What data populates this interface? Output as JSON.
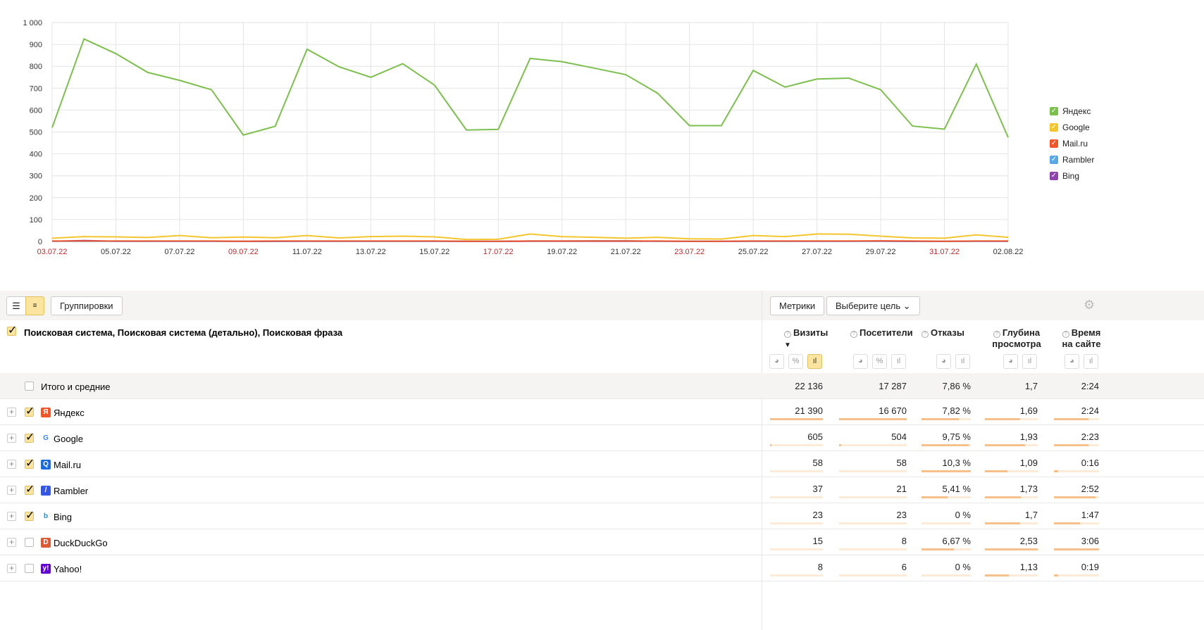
{
  "chart_data": {
    "type": "line",
    "title": "",
    "xlabel": "",
    "ylabel": "",
    "ylim": [
      0,
      1000
    ],
    "yticks": [
      "0",
      "100",
      "200",
      "300",
      "400",
      "500",
      "600",
      "700",
      "800",
      "900",
      "1 000"
    ],
    "x": [
      "03.07.22",
      "04.07.22",
      "05.07.22",
      "06.07.22",
      "07.07.22",
      "08.07.22",
      "09.07.22",
      "10.07.22",
      "11.07.22",
      "12.07.22",
      "13.07.22",
      "14.07.22",
      "15.07.22",
      "16.07.22",
      "17.07.22",
      "18.07.22",
      "19.07.22",
      "20.07.22",
      "21.07.22",
      "22.07.22",
      "23.07.22",
      "24.07.22",
      "25.07.22",
      "26.07.22",
      "27.07.22",
      "28.07.22",
      "29.07.22",
      "30.07.22",
      "31.07.22",
      "01.08.22",
      "02.08.22"
    ],
    "xticks": [
      "03.07.22",
      "05.07.22",
      "07.07.22",
      "09.07.22",
      "11.07.22",
      "13.07.22",
      "15.07.22",
      "17.07.22",
      "19.07.22",
      "21.07.22",
      "23.07.22",
      "25.07.22",
      "27.07.22",
      "29.07.22",
      "31.07.22",
      "02.08.22"
    ],
    "weekend_ticks": [
      "03.07.22",
      "09.07.22",
      "17.07.22",
      "23.07.22",
      "31.07.22"
    ],
    "grid": true,
    "legend_position": "right",
    "series": [
      {
        "name": "Яндекс",
        "color": "#7dbf4e",
        "values": [
          520,
          925,
          858,
          772,
          736,
          693,
          486,
          526,
          878,
          798,
          750,
          812,
          714,
          509,
          512,
          836,
          821,
          792,
          762,
          677,
          529,
          529,
          781,
          705,
          742,
          746,
          693,
          527,
          513,
          810,
          475
        ]
      },
      {
        "name": "Google",
        "color": "#f5c52e",
        "values": [
          15,
          22,
          21,
          18,
          27,
          17,
          20,
          17,
          27,
          16,
          22,
          24,
          21,
          9,
          10,
          34,
          22,
          19,
          15,
          19,
          12,
          11,
          27,
          22,
          34,
          33,
          24,
          16,
          15,
          30,
          19
        ]
      },
      {
        "name": "Mail.ru",
        "color": "#f0562a",
        "values": [
          2,
          2,
          2,
          2,
          2,
          2,
          1,
          2,
          2,
          2,
          2,
          2,
          2,
          1,
          1,
          2,
          2,
          2,
          2,
          2,
          1,
          1,
          2,
          2,
          2,
          2,
          3,
          2,
          1,
          2,
          2
        ]
      },
      {
        "name": "Rambler",
        "color": "#5aa7e6",
        "values": [
          1,
          1,
          1,
          1,
          1,
          1,
          1,
          1,
          1,
          1,
          1,
          1,
          1,
          1,
          1,
          2,
          2,
          3,
          3,
          1,
          1,
          1,
          1,
          1,
          1,
          1,
          2,
          1,
          1,
          1,
          1
        ]
      },
      {
        "name": "Bing",
        "color": "#8e44ad",
        "values": [
          1,
          4,
          1,
          1,
          1,
          1,
          0,
          0,
          1,
          1,
          1,
          1,
          1,
          0,
          0,
          1,
          1,
          1,
          1,
          1,
          0,
          0,
          1,
          1,
          1,
          1,
          1,
          0,
          0,
          1,
          1
        ]
      }
    ]
  },
  "toolbar": {
    "groupings": "Группировки",
    "metrics": "Метрики",
    "goal": "Выберите цель"
  },
  "table": {
    "dimension_header": "Поисковая система, Поисковая система (детально), Поисковая фраза",
    "columns": [
      "Визиты",
      "Посетители",
      "Отказы",
      "Глубина просмотра",
      "Время на сайте"
    ],
    "sort_indicator": "▼",
    "totals": {
      "label": "Итого и средние",
      "values": [
        "22 136",
        "17 287",
        "7,86 %",
        "1,7",
        "2:24"
      ]
    },
    "rows": [
      {
        "name": "Яндекс",
        "checked": true,
        "icon": "Я",
        "icon_color": "#f0562a",
        "values": [
          "21 390",
          "16 670",
          "7,82 %",
          "1,69",
          "2:24"
        ],
        "fractions": [
          1,
          1,
          0.76,
          0.67,
          0.77
        ]
      },
      {
        "name": "Google",
        "checked": true,
        "icon": "G",
        "icon_color": "#ffffff",
        "values": [
          "605",
          "504",
          "9,75 %",
          "1,93",
          "2:23"
        ],
        "fractions": [
          0.03,
          0.03,
          0.95,
          0.76,
          0.77
        ]
      },
      {
        "name": "Mail.ru",
        "checked": true,
        "icon": "Q",
        "icon_color": "#1a6be0",
        "values": [
          "58",
          "58",
          "10,3 %",
          "1,09",
          "0:16"
        ],
        "fractions": [
          0,
          0,
          1,
          0.43,
          0.09
        ]
      },
      {
        "name": "Rambler",
        "checked": true,
        "icon": "/",
        "icon_color": "#3556e8",
        "values": [
          "37",
          "21",
          "5,41 %",
          "1,73",
          "2:52"
        ],
        "fractions": [
          0,
          0,
          0.53,
          0.68,
          0.92
        ]
      },
      {
        "name": "Bing",
        "checked": true,
        "icon": "b",
        "icon_color": "#ffffff",
        "values": [
          "23",
          "23",
          "0 %",
          "1,7",
          "1:47"
        ],
        "fractions": [
          0,
          0,
          0,
          0.67,
          0.58
        ]
      },
      {
        "name": "DuckDuckGo",
        "checked": false,
        "icon": "D",
        "icon_color": "#de5833",
        "values": [
          "15",
          "8",
          "6,67 %",
          "2,53",
          "3:06"
        ],
        "fractions": [
          0,
          0,
          0.65,
          1,
          1
        ]
      },
      {
        "name": "Yahoo!",
        "checked": false,
        "icon": "y!",
        "icon_color": "#6001d2",
        "values": [
          "8",
          "6",
          "0 %",
          "1,13",
          "0:19"
        ],
        "fractions": [
          0,
          0,
          0,
          0.45,
          0.1
        ]
      }
    ]
  }
}
